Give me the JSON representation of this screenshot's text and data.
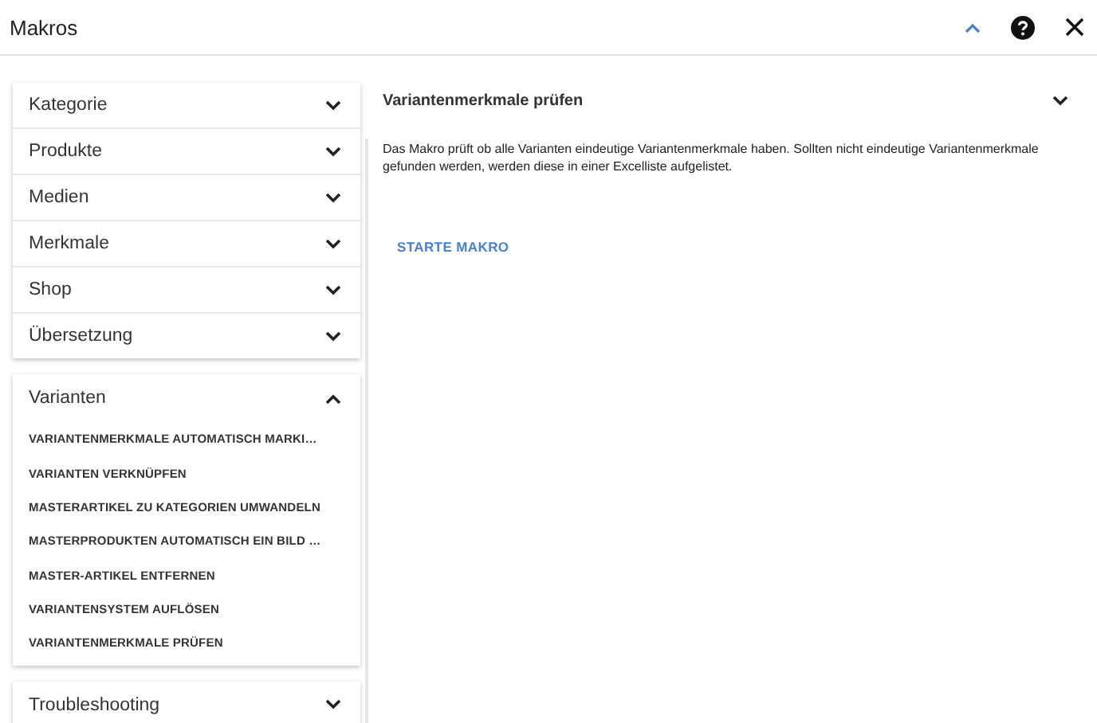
{
  "window": {
    "title": "Makros"
  },
  "cards": [
    {
      "sections": [
        {
          "label": "Kategorie",
          "expanded": false
        },
        {
          "label": "Produkte",
          "expanded": false
        },
        {
          "label": "Medien",
          "expanded": false
        },
        {
          "label": "Merkmale",
          "expanded": false
        },
        {
          "label": "Shop",
          "expanded": false
        },
        {
          "label": "Übersetzung",
          "expanded": false
        }
      ]
    },
    {
      "sections": [
        {
          "label": "Varianten",
          "expanded": true,
          "items": [
            "VARIANTENMERKMALE AUTOMATISCH MARKI…",
            "VARIANTEN VERKNÜPFEN",
            "MASTERARTIKEL ZU KATEGORIEN UMWANDELN",
            "MASTERPRODUKTEN AUTOMATISCH EIN BILD …",
            "MASTER-ARTIKEL ENTFERNEN",
            "VARIANTENSYSTEM AUFLÖSEN",
            "VARIANTENMERKMALE PRÜFEN"
          ]
        }
      ]
    },
    {
      "sections": [
        {
          "label": "Troubleshooting",
          "expanded": false
        }
      ]
    }
  ],
  "detail": {
    "title": "Variantenmerkmale prüfen",
    "expanded": false,
    "description": "Das Makro prüft ob alle Varianten eindeutige Variantenmerkmale haben. Sollten nicht eindeutige Variantenmerkmale gefunden werden, werden diese in einer Excelliste aufgelistet.",
    "button": "STARTE MAKRO"
  }
}
